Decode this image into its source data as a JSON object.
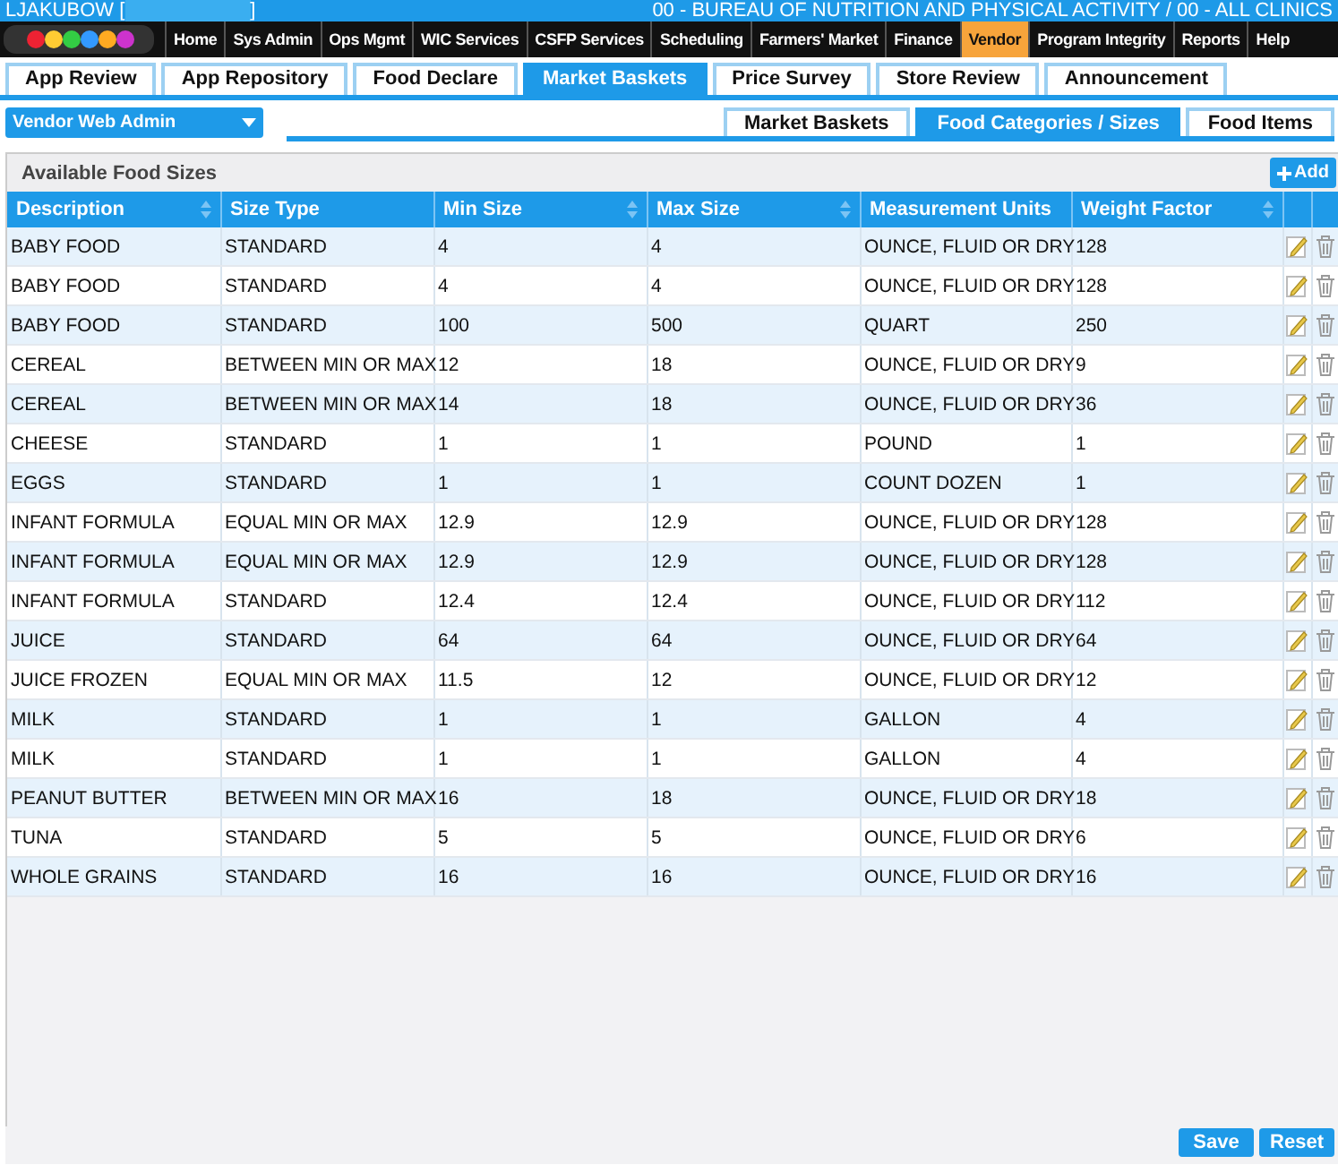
{
  "header": {
    "user": "LJAKUBOW [",
    "user_close": "]",
    "agency": "00 - BUREAU OF NUTRITION AND PHYSICAL ACTIVITY / 00 - ALL CLINICS"
  },
  "menu": [
    {
      "label": "Home",
      "selected": false
    },
    {
      "label": "Sys Admin",
      "selected": false
    },
    {
      "label": "Ops Mgmt",
      "selected": false
    },
    {
      "label": "WIC Services",
      "selected": false
    },
    {
      "label": "CSFP Services",
      "selected": false
    },
    {
      "label": "Scheduling",
      "selected": false
    },
    {
      "label": "Farmers' Market",
      "selected": false
    },
    {
      "label": "Finance",
      "selected": false
    },
    {
      "label": "Vendor",
      "selected": true
    },
    {
      "label": "Program Integrity",
      "selected": false
    },
    {
      "label": "Reports",
      "selected": false
    },
    {
      "label": "Help",
      "selected": false
    }
  ],
  "tabs": [
    {
      "label": "App Review",
      "selected": false
    },
    {
      "label": "App Repository",
      "selected": false
    },
    {
      "label": "Food Declare",
      "selected": false
    },
    {
      "label": "Market Baskets",
      "selected": true
    },
    {
      "label": "Price Survey",
      "selected": false
    },
    {
      "label": "Store Review",
      "selected": false
    },
    {
      "label": "Announcement",
      "selected": false
    }
  ],
  "role_dropdown": {
    "value": "Vendor Web Admin"
  },
  "subtabs": [
    {
      "label": "Market Baskets",
      "selected": false
    },
    {
      "label": "Food Categories / Sizes",
      "selected": true
    },
    {
      "label": "Food Items",
      "selected": false
    }
  ],
  "panel": {
    "title": "Available Food Sizes",
    "add_button": "Add"
  },
  "table": {
    "columns": [
      {
        "label": "Description",
        "sortable": true
      },
      {
        "label": "Size Type",
        "sortable": false
      },
      {
        "label": "Min Size",
        "sortable": true
      },
      {
        "label": "Max Size",
        "sortable": true
      },
      {
        "label": "Measurement Units",
        "sortable": false
      },
      {
        "label": "Weight Factor",
        "sortable": true
      }
    ],
    "rows": [
      [
        "BABY FOOD",
        "STANDARD",
        "4",
        "4",
        "OUNCE, FLUID OR DRY",
        "128"
      ],
      [
        "BABY FOOD",
        "STANDARD",
        "4",
        "4",
        "OUNCE, FLUID OR DRY",
        "128"
      ],
      [
        "BABY FOOD",
        "STANDARD",
        "100",
        "500",
        "QUART",
        "250"
      ],
      [
        "CEREAL",
        "BETWEEN MIN OR MAX",
        "12",
        "18",
        "OUNCE, FLUID OR DRY",
        "9"
      ],
      [
        "CEREAL",
        "BETWEEN MIN OR MAX",
        "14",
        "18",
        "OUNCE, FLUID OR DRY",
        "36"
      ],
      [
        "CHEESE",
        "STANDARD",
        "1",
        "1",
        "POUND",
        "1"
      ],
      [
        "EGGS",
        "STANDARD",
        "1",
        "1",
        "COUNT DOZEN",
        "1"
      ],
      [
        "INFANT FORMULA",
        "EQUAL MIN OR MAX",
        "12.9",
        "12.9",
        "OUNCE, FLUID OR DRY",
        "128"
      ],
      [
        "INFANT FORMULA",
        "EQUAL MIN OR MAX",
        "12.9",
        "12.9",
        "OUNCE, FLUID OR DRY",
        "128"
      ],
      [
        "INFANT FORMULA",
        "STANDARD",
        "12.4",
        "12.4",
        "OUNCE, FLUID OR DRY",
        "112"
      ],
      [
        "JUICE",
        "STANDARD",
        "64",
        "64",
        "OUNCE, FLUID OR DRY",
        "64"
      ],
      [
        "JUICE FROZEN",
        "EQUAL MIN OR MAX",
        "11.5",
        "12",
        "OUNCE, FLUID OR DRY",
        "12"
      ],
      [
        "MILK",
        "STANDARD",
        "1",
        "1",
        "GALLON",
        "4"
      ],
      [
        "MILK",
        "STANDARD",
        "1",
        "1",
        "GALLON",
        "4"
      ],
      [
        "PEANUT BUTTER",
        "BETWEEN MIN OR MAX",
        "16",
        "18",
        "OUNCE, FLUID OR DRY",
        "18"
      ],
      [
        "TUNA",
        "STANDARD",
        "5",
        "5",
        "OUNCE, FLUID OR DRY",
        "6"
      ],
      [
        "WHOLE GRAINS",
        "STANDARD",
        "16",
        "16",
        "OUNCE, FLUID OR DRY",
        "16"
      ]
    ]
  },
  "footer_buttons": [
    "Save",
    "Reset"
  ]
}
